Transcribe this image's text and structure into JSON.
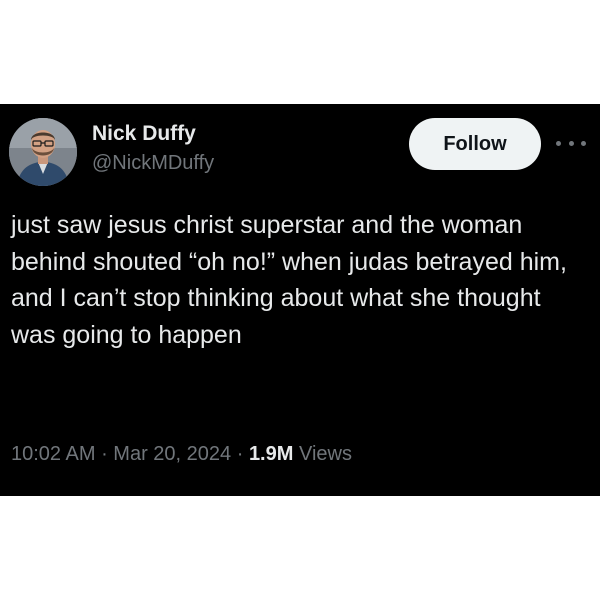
{
  "author": {
    "display_name": "Nick Duffy",
    "handle": "@NickMDuffy",
    "avatar_icon": "user-avatar-photo"
  },
  "actions": {
    "follow_label": "Follow",
    "more_icon": "more-horizontal-icon"
  },
  "tweet": {
    "text": "just saw jesus christ superstar and the woman behind shouted “oh no!” when judas betrayed him, and I can’t stop thinking about what she thought was going to happen"
  },
  "meta": {
    "time": "10:02 AM",
    "separator": " · ",
    "date": "Mar 20, 2024",
    "views_count": "1.9M",
    "views_label": "Views"
  },
  "colors": {
    "card_background": "#000000",
    "primary_text": "#e7e9ea",
    "secondary_text": "#71767b",
    "follow_button_bg": "#eff3f4",
    "follow_button_text": "#0f1419"
  }
}
